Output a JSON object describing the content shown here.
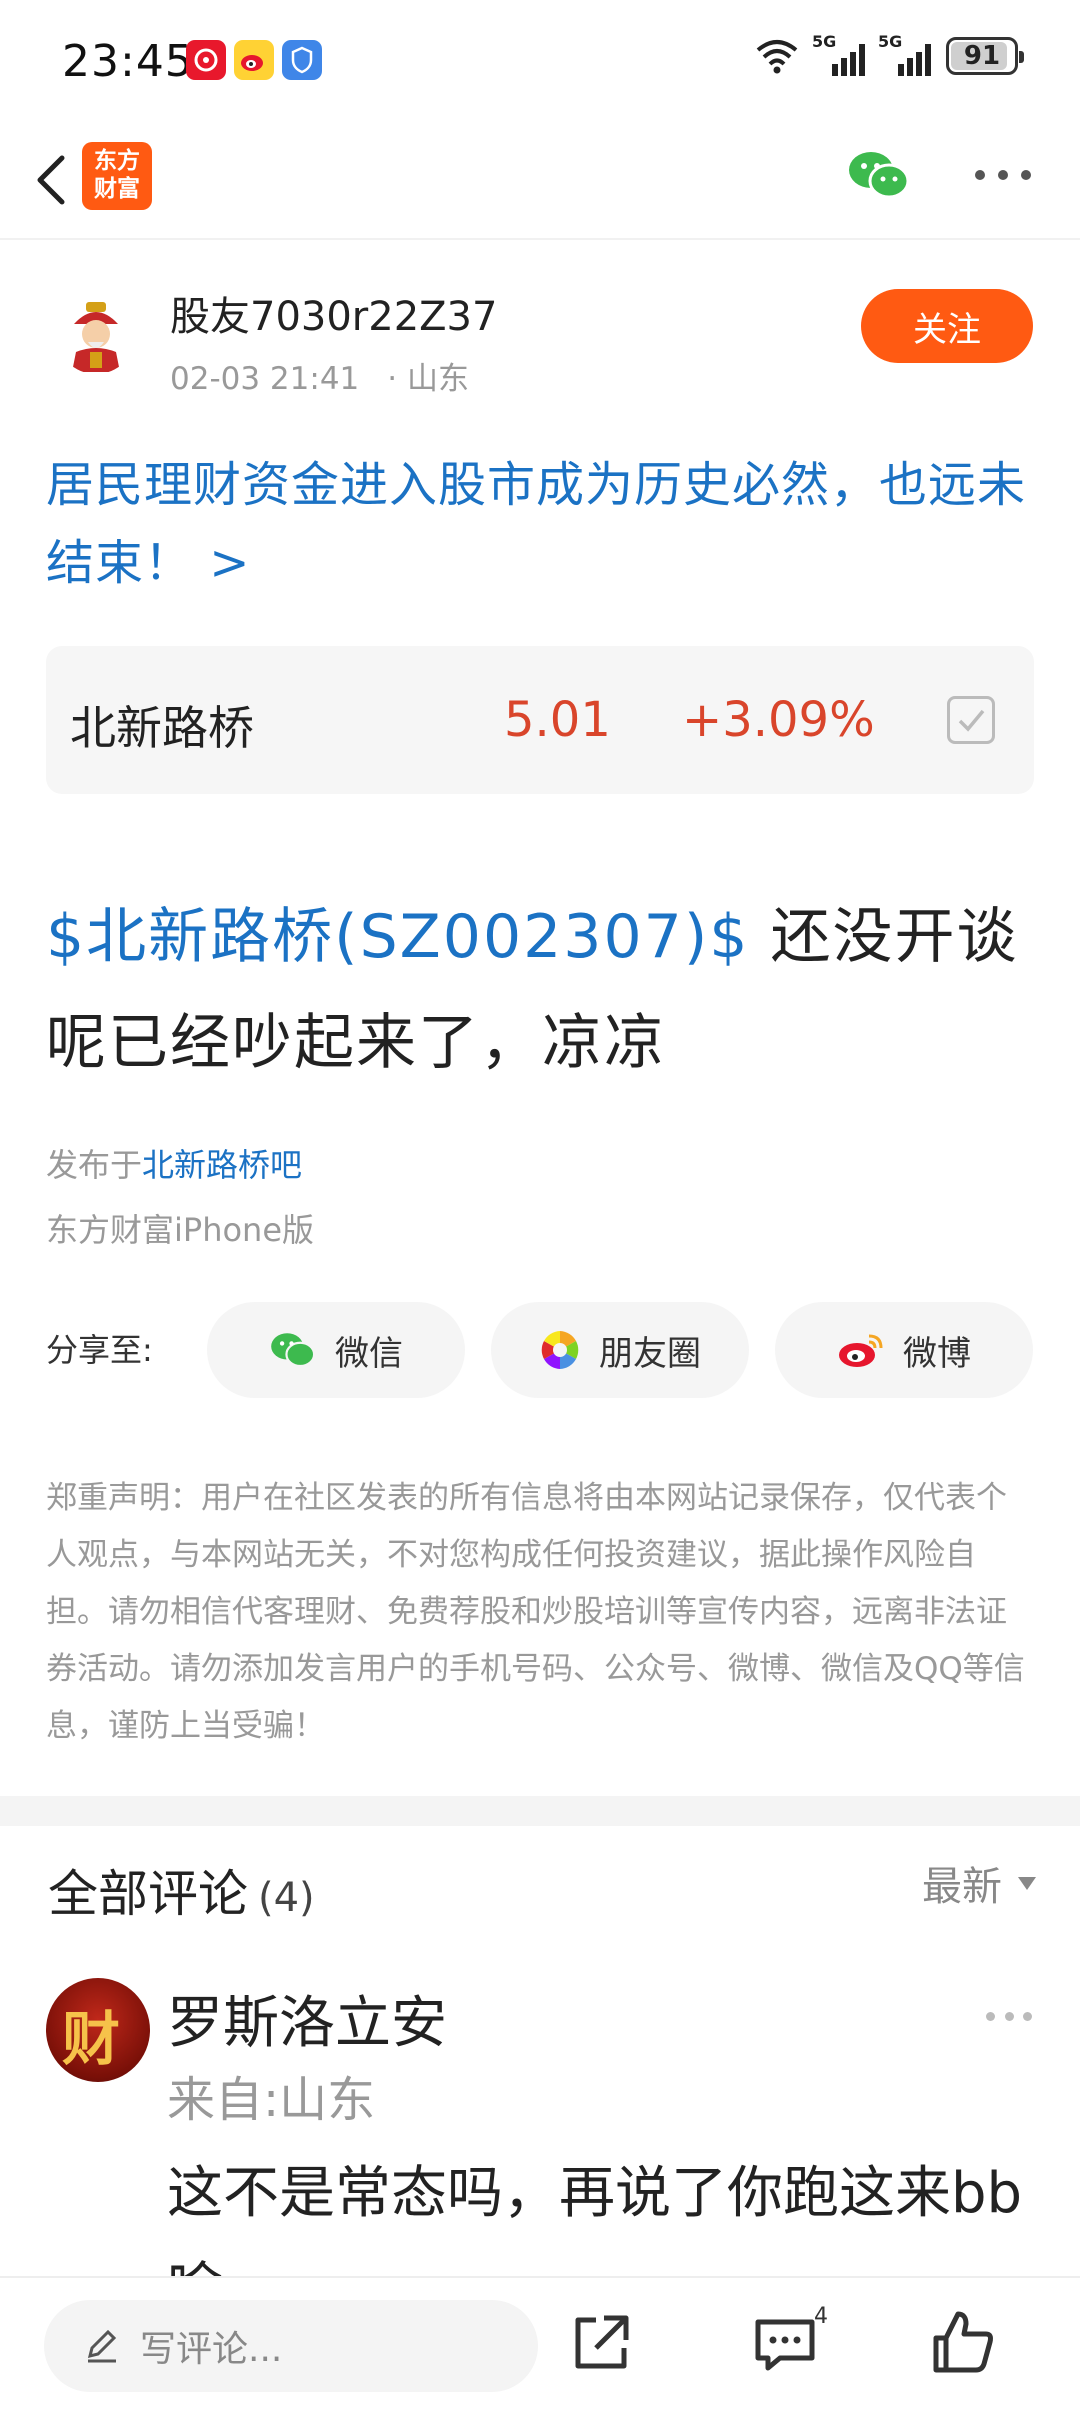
{
  "status_bar": {
    "time": "23:45",
    "signal1": "5G",
    "signal2": "5G",
    "battery": "91",
    "battery_level": 0.91
  },
  "nav": {
    "logo_line1": "东方",
    "logo_line2": "财富"
  },
  "post": {
    "author": "股友7030r22Z37",
    "datetime": "02-03 21:41",
    "location": "· 山东",
    "follow_label": "关注",
    "headline": "居民理财资金进入股市成为历史必然，也远未结束！ >",
    "stock": {
      "name": "北新路桥",
      "price": "5.01",
      "change": "+3.09%"
    },
    "tag": "$北新路桥(SZ002307)$",
    "body": " 还没开谈呢已经吵起来了，凉凉",
    "published_prefix": "发布于",
    "published_bar": "北新路桥吧",
    "device": "东方财富iPhone版"
  },
  "share": {
    "label": "分享至:",
    "wechat": "微信",
    "moments": "朋友圈",
    "weibo": "微博"
  },
  "disclaimer": "郑重声明：用户在社区发表的所有信息将由本网站记录保存，仅代表个人观点，与本网站无关，不对您构成任何投资建议，据此操作风险自担。请勿相信代客理财、免费荐股和炒股培训等宣传内容，远离非法证券活动。请勿添加发言用户的手机号码、公众号、微博、微信及QQ等信息，谨防上当受骗！",
  "comments": {
    "title": "全部评论",
    "count": "(4)",
    "sort": "最新",
    "items": [
      {
        "avatar_char": "财",
        "user": "罗斯洛立安",
        "location": "来自:山东",
        "text": "这不是常态吗，再说了你跑这来bb啥"
      }
    ]
  },
  "bottom_bar": {
    "write_placeholder": "写评论...",
    "comment_badge": "4"
  },
  "colors": {
    "brand_orange": "#ff5a12",
    "link_blue": "#1b72c4",
    "up_red": "#d9452b"
  }
}
